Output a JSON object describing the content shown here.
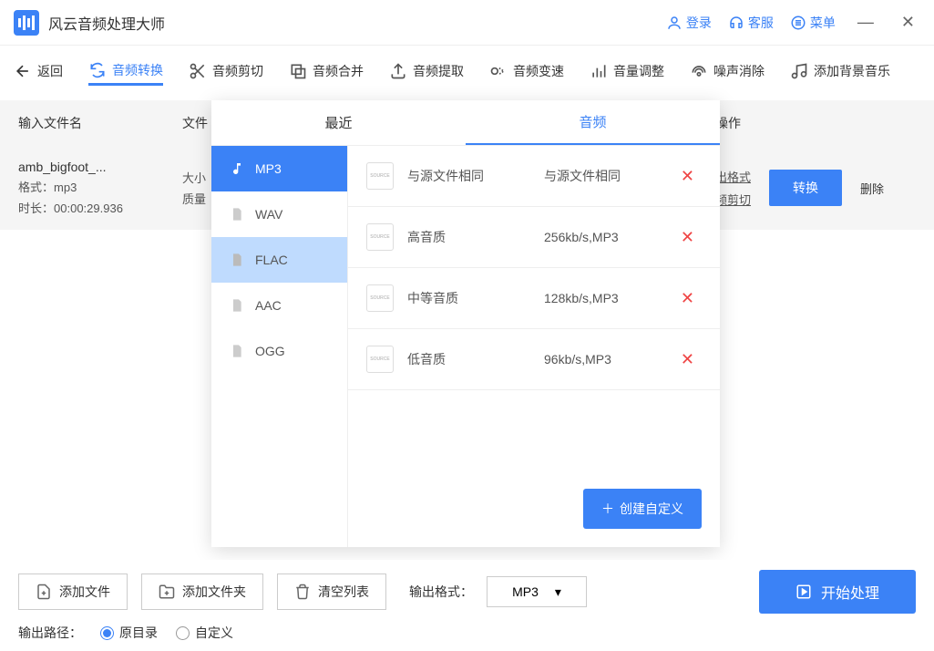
{
  "app": {
    "title": "风云音频处理大师"
  },
  "titlebar": {
    "login": "登录",
    "support": "客服",
    "menu": "菜单"
  },
  "toolbar": {
    "back": "返回",
    "convert": "音频转换",
    "cut": "音频剪切",
    "merge": "音频合并",
    "extract": "音频提取",
    "speed": "音频变速",
    "volume": "音量调整",
    "noise": "噪声消除",
    "bgm": "添加背景音乐"
  },
  "columns": {
    "name": "输入文件名",
    "info": "文件",
    "ops": "操作"
  },
  "file": {
    "name": "amb_bigfoot_...",
    "format_label": "格式：",
    "format_value": "mp3",
    "duration_label": "时长：",
    "duration_value": "00:00:29.936",
    "size_label": "大小",
    "quality_label": "质量",
    "out_format": "出格式",
    "cut": "频剪切",
    "convert_btn": "转换",
    "delete": "删除"
  },
  "dropdown": {
    "tabs": {
      "recent": "最近",
      "audio": "音频"
    },
    "formats": [
      "MP3",
      "WAV",
      "FLAC",
      "AAC",
      "OGG"
    ],
    "options": [
      {
        "name": "与源文件相同",
        "value": "与源文件相同"
      },
      {
        "name": "高音质",
        "value": "256kb/s,MP3"
      },
      {
        "name": "中等音质",
        "value": "128kb/s,MP3"
      },
      {
        "name": "低音质",
        "value": "96kb/s,MP3"
      }
    ],
    "create": "创建自定义"
  },
  "footer": {
    "add_file": "添加文件",
    "add_folder": "添加文件夹",
    "clear": "清空列表",
    "out_format_label": "输出格式：",
    "out_format_value": "MP3",
    "start": "开始处理",
    "out_path_label": "输出路径：",
    "radio_orig": "原目录",
    "radio_custom": "自定义"
  }
}
